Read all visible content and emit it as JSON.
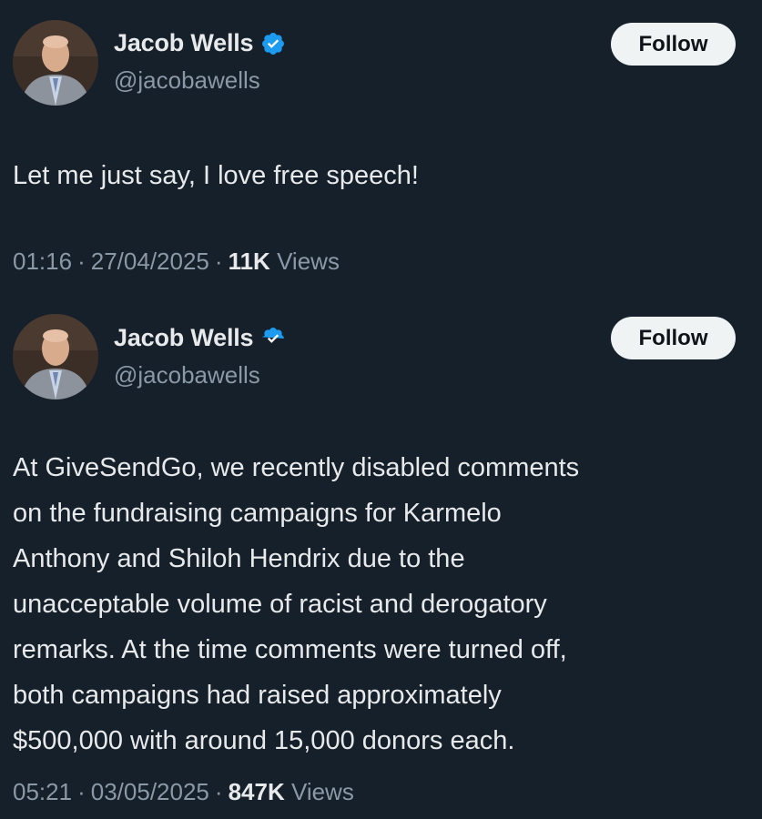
{
  "colors": {
    "background": "#15202b",
    "primary_text": "#e7e9ea",
    "secondary_text": "#8b98a5",
    "verified_badge": "#1d9bf0",
    "follow_button_bg": "#eff3f4"
  },
  "tweets": [
    {
      "author": {
        "name": "Jacob Wells",
        "handle": "@jacobawells",
        "verified_icon": "verified-badge-icon"
      },
      "follow_label": "Follow",
      "text_lines": [
        "Let me just say, I love free speech!"
      ],
      "time": "01:16",
      "date": "27/04/2025",
      "separator": "·",
      "views_count": "11K",
      "views_label": "Views"
    },
    {
      "author": {
        "name": "Jacob Wells",
        "handle": "@jacobawells",
        "verified_icon": "verified-badge-icon"
      },
      "follow_label": "Follow",
      "text_lines": [
        "At GiveSendGo, we recently disabled comments",
        "on the fundraising campaigns for Karmelo",
        "Anthony and Shiloh Hendrix due to the",
        "unacceptable volume of racist and derogatory",
        "remarks. At the time comments were turned off,",
        "both campaigns had raised approximately",
        "$500,000 with around 15,000 donors each."
      ],
      "time": "05:21",
      "date": "03/05/2025",
      "separator": "·",
      "views_count": "847K",
      "views_label": "Views"
    }
  ]
}
